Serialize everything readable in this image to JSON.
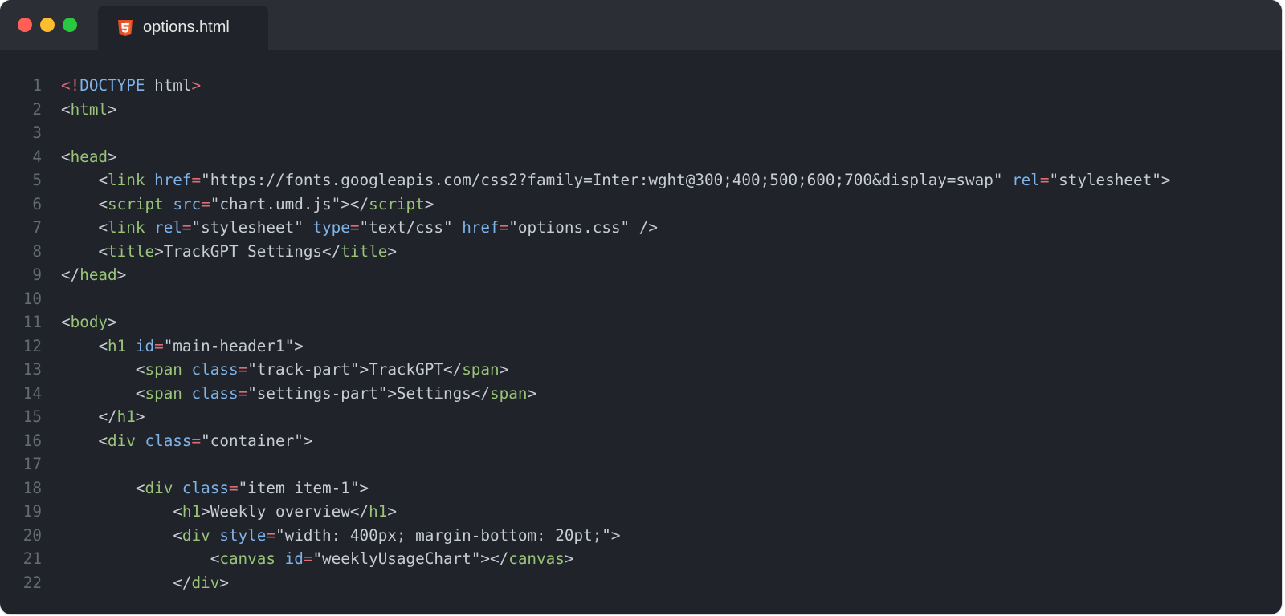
{
  "window": {
    "traffic_lights": [
      {
        "name": "close",
        "color": "#ff5f57"
      },
      {
        "name": "minimize",
        "color": "#febc2e"
      },
      {
        "name": "maximize",
        "color": "#28c840"
      }
    ]
  },
  "tab": {
    "label": "options.html",
    "icon": "html5-icon",
    "icon_color": "#e44d26"
  },
  "colors": {
    "tag": "#98c379",
    "attribute": "#7fb3e8",
    "equals": "#e06c75",
    "text": "#c8ccd4",
    "line_number": "#646a76",
    "background": "#20232a",
    "titlebar": "#2b2e35"
  },
  "code_lines": [
    {
      "n": "1",
      "tokens": [
        [
          "bang",
          "<!"
        ],
        [
          "attr",
          "DOCTYPE"
        ],
        [
          "text",
          " html"
        ],
        [
          "bang",
          ">"
        ]
      ]
    },
    {
      "n": "2",
      "tokens": [
        [
          "punct",
          "<"
        ],
        [
          "tag",
          "html"
        ],
        [
          "punct",
          ">"
        ]
      ]
    },
    {
      "n": "3",
      "tokens": []
    },
    {
      "n": "4",
      "tokens": [
        [
          "punct",
          "<"
        ],
        [
          "tag",
          "head"
        ],
        [
          "punct",
          ">"
        ]
      ]
    },
    {
      "n": "5",
      "tokens": [
        [
          "text",
          "    "
        ],
        [
          "punct",
          "<"
        ],
        [
          "tag",
          "link"
        ],
        [
          "text",
          " "
        ],
        [
          "attr",
          "href"
        ],
        [
          "eq",
          "="
        ],
        [
          "str",
          "\"https://fonts.googleapis.com/css2?family=Inter:wght@300;400;500;600;700&display=swap\""
        ],
        [
          "text",
          " "
        ],
        [
          "attr",
          "rel"
        ],
        [
          "eq",
          "="
        ],
        [
          "str",
          "\"stylesheet\""
        ],
        [
          "punct",
          ">"
        ]
      ]
    },
    {
      "n": "6",
      "tokens": [
        [
          "text",
          "    "
        ],
        [
          "punct",
          "<"
        ],
        [
          "tag",
          "script"
        ],
        [
          "text",
          " "
        ],
        [
          "attr",
          "src"
        ],
        [
          "eq",
          "="
        ],
        [
          "str",
          "\"chart.umd.js\""
        ],
        [
          "punct",
          "></"
        ],
        [
          "tag",
          "script"
        ],
        [
          "punct",
          ">"
        ]
      ]
    },
    {
      "n": "7",
      "tokens": [
        [
          "text",
          "    "
        ],
        [
          "punct",
          "<"
        ],
        [
          "tag",
          "link"
        ],
        [
          "text",
          " "
        ],
        [
          "attr",
          "rel"
        ],
        [
          "eq",
          "="
        ],
        [
          "str",
          "\"stylesheet\""
        ],
        [
          "text",
          " "
        ],
        [
          "attr",
          "type"
        ],
        [
          "eq",
          "="
        ],
        [
          "str",
          "\"text/css\""
        ],
        [
          "text",
          " "
        ],
        [
          "attr",
          "href"
        ],
        [
          "eq",
          "="
        ],
        [
          "str",
          "\"options.css\""
        ],
        [
          "text",
          " "
        ],
        [
          "punct",
          "/>"
        ]
      ]
    },
    {
      "n": "8",
      "tokens": [
        [
          "text",
          "    "
        ],
        [
          "punct",
          "<"
        ],
        [
          "tag",
          "title"
        ],
        [
          "punct",
          ">"
        ],
        [
          "text",
          "TrackGPT Settings"
        ],
        [
          "punct",
          "</"
        ],
        [
          "tag",
          "title"
        ],
        [
          "punct",
          ">"
        ]
      ]
    },
    {
      "n": "9",
      "tokens": [
        [
          "punct",
          "</"
        ],
        [
          "tag",
          "head"
        ],
        [
          "punct",
          ">"
        ]
      ]
    },
    {
      "n": "10",
      "tokens": []
    },
    {
      "n": "11",
      "tokens": [
        [
          "punct",
          "<"
        ],
        [
          "tag",
          "body"
        ],
        [
          "punct",
          ">"
        ]
      ]
    },
    {
      "n": "12",
      "tokens": [
        [
          "text",
          "    "
        ],
        [
          "punct",
          "<"
        ],
        [
          "tag",
          "h1"
        ],
        [
          "text",
          " "
        ],
        [
          "attr",
          "id"
        ],
        [
          "eq",
          "="
        ],
        [
          "str",
          "\"main-header1\""
        ],
        [
          "punct",
          ">"
        ]
      ]
    },
    {
      "n": "13",
      "tokens": [
        [
          "text",
          "        "
        ],
        [
          "punct",
          "<"
        ],
        [
          "tag",
          "span"
        ],
        [
          "text",
          " "
        ],
        [
          "attr",
          "class"
        ],
        [
          "eq",
          "="
        ],
        [
          "str",
          "\"track-part\""
        ],
        [
          "punct",
          ">"
        ],
        [
          "text",
          "TrackGPT"
        ],
        [
          "punct",
          "</"
        ],
        [
          "tag",
          "span"
        ],
        [
          "punct",
          ">"
        ]
      ]
    },
    {
      "n": "14",
      "tokens": [
        [
          "text",
          "        "
        ],
        [
          "punct",
          "<"
        ],
        [
          "tag",
          "span"
        ],
        [
          "text",
          " "
        ],
        [
          "attr",
          "class"
        ],
        [
          "eq",
          "="
        ],
        [
          "str",
          "\"settings-part\""
        ],
        [
          "punct",
          ">"
        ],
        [
          "text",
          "Settings"
        ],
        [
          "punct",
          "</"
        ],
        [
          "tag",
          "span"
        ],
        [
          "punct",
          ">"
        ]
      ]
    },
    {
      "n": "15",
      "tokens": [
        [
          "text",
          "    "
        ],
        [
          "punct",
          "</"
        ],
        [
          "tag",
          "h1"
        ],
        [
          "punct",
          ">"
        ]
      ]
    },
    {
      "n": "16",
      "tokens": [
        [
          "text",
          "    "
        ],
        [
          "punct",
          "<"
        ],
        [
          "tag",
          "div"
        ],
        [
          "text",
          " "
        ],
        [
          "attr",
          "class"
        ],
        [
          "eq",
          "="
        ],
        [
          "str",
          "\"container\""
        ],
        [
          "punct",
          ">"
        ]
      ]
    },
    {
      "n": "17",
      "tokens": []
    },
    {
      "n": "18",
      "tokens": [
        [
          "text",
          "        "
        ],
        [
          "punct",
          "<"
        ],
        [
          "tag",
          "div"
        ],
        [
          "text",
          " "
        ],
        [
          "attr",
          "class"
        ],
        [
          "eq",
          "="
        ],
        [
          "str",
          "\"item item-1\""
        ],
        [
          "punct",
          ">"
        ]
      ]
    },
    {
      "n": "19",
      "tokens": [
        [
          "text",
          "            "
        ],
        [
          "punct",
          "<"
        ],
        [
          "tag",
          "h1"
        ],
        [
          "punct",
          ">"
        ],
        [
          "text",
          "Weekly overview"
        ],
        [
          "punct",
          "</"
        ],
        [
          "tag",
          "h1"
        ],
        [
          "punct",
          ">"
        ]
      ]
    },
    {
      "n": "20",
      "tokens": [
        [
          "text",
          "            "
        ],
        [
          "punct",
          "<"
        ],
        [
          "tag",
          "div"
        ],
        [
          "text",
          " "
        ],
        [
          "attr",
          "style"
        ],
        [
          "eq",
          "="
        ],
        [
          "str",
          "\"width: 400px; margin-bottom: 20pt;\""
        ],
        [
          "punct",
          ">"
        ]
      ]
    },
    {
      "n": "21",
      "tokens": [
        [
          "text",
          "                "
        ],
        [
          "punct",
          "<"
        ],
        [
          "tag",
          "canvas"
        ],
        [
          "text",
          " "
        ],
        [
          "attr",
          "id"
        ],
        [
          "eq",
          "="
        ],
        [
          "str",
          "\"weeklyUsageChart\""
        ],
        [
          "punct",
          "></"
        ],
        [
          "tag",
          "canvas"
        ],
        [
          "punct",
          ">"
        ]
      ]
    },
    {
      "n": "22",
      "tokens": [
        [
          "text",
          "            "
        ],
        [
          "punct",
          "</"
        ],
        [
          "tag",
          "div"
        ],
        [
          "punct",
          ">"
        ]
      ]
    }
  ]
}
